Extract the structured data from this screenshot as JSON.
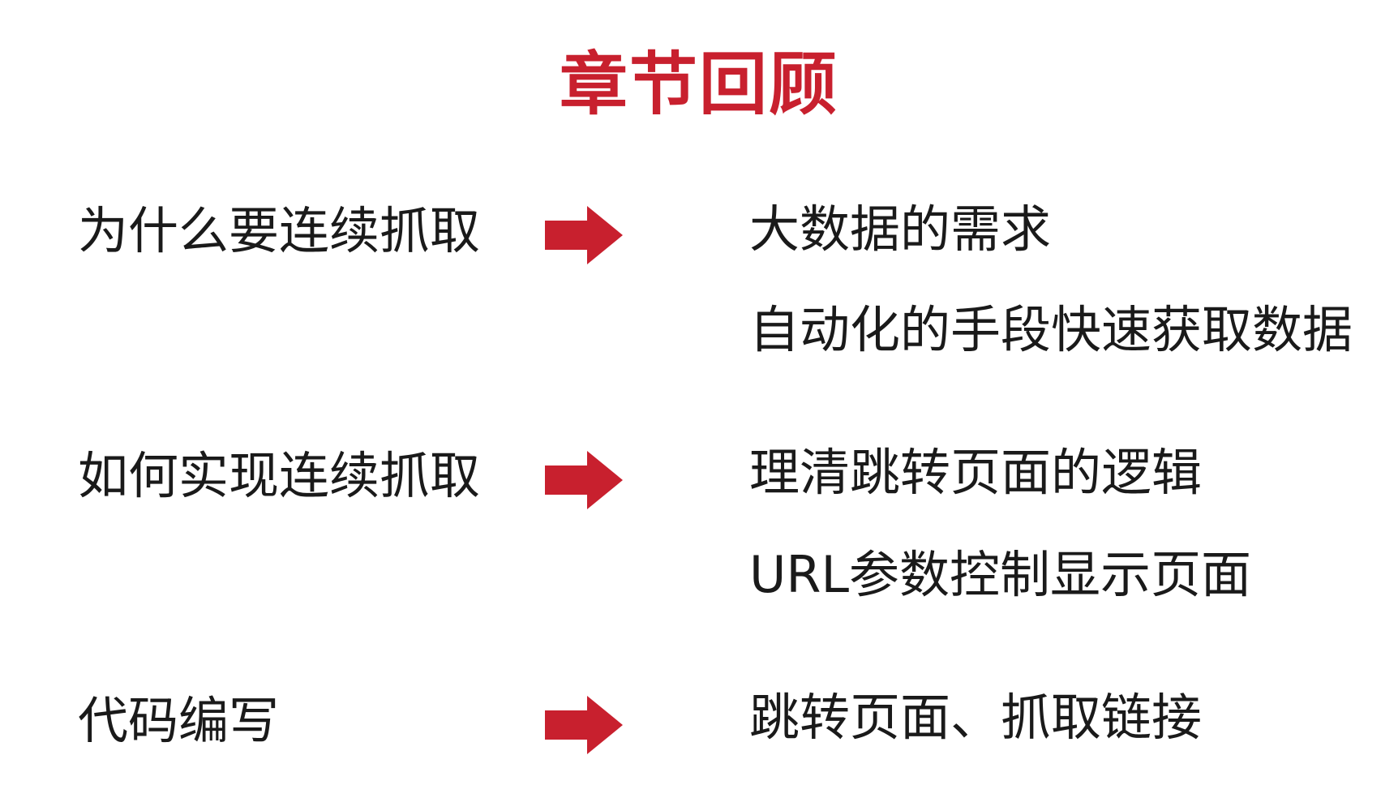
{
  "slide": {
    "title": "章节回顾",
    "accent_color": "#c8202e",
    "rows": [
      {
        "label": "为什么要连续抓取",
        "arrow_icon": "right-arrow",
        "points": [
          "大数据的需求",
          "自动化的手段快速获取数据"
        ]
      },
      {
        "label": "如何实现连续抓取",
        "arrow_icon": "right-arrow",
        "points": [
          "理清跳转页面的逻辑",
          "URL参数控制显示页面"
        ]
      },
      {
        "label": "代码编写",
        "arrow_icon": "right-arrow",
        "points": [
          "跳转页面、抓取链接"
        ]
      }
    ]
  }
}
